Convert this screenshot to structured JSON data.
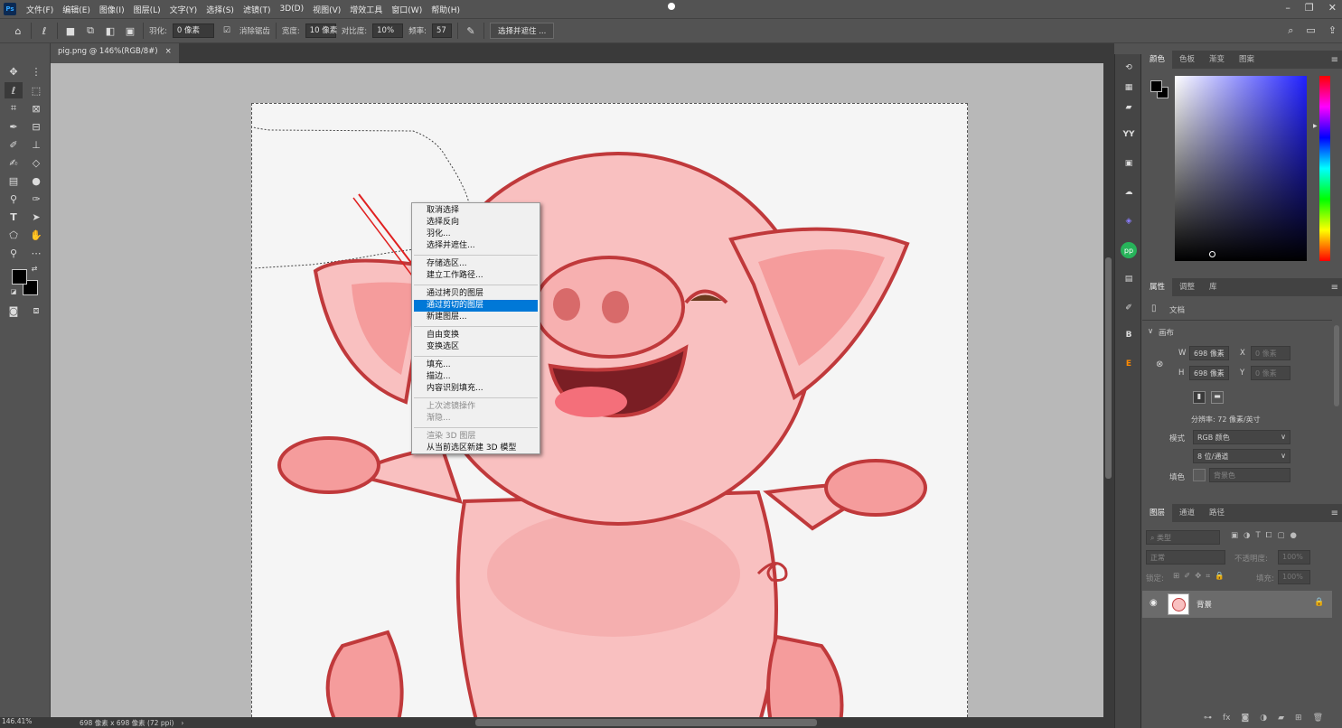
{
  "app": {
    "logo": "Ps"
  },
  "menu": [
    "文件(F)",
    "编辑(E)",
    "图像(I)",
    "图层(L)",
    "文字(Y)",
    "选择(S)",
    "滤镜(T)",
    "3D(D)",
    "视图(V)",
    "增效工具",
    "窗口(W)",
    "帮助(H)"
  ],
  "options": {
    "feather_label": "羽化:",
    "feather_value": "0 像素",
    "antialias_label": "消除锯齿",
    "width_label": "宽度:",
    "width_value": "10 像素",
    "contrast_label": "对比度:",
    "contrast_value": "10%",
    "frequency_label": "频率:",
    "frequency_value": "57",
    "select_mask_button": "选择并遮住 ..."
  },
  "document": {
    "tab_title": "pig.png @ 146%(RGB/8#)",
    "close": "×",
    "zoom": "146.41%",
    "info": "698 像素 x 698 像素 (72 ppi)"
  },
  "context_menu": {
    "items": [
      "取消选择",
      "选择反向",
      "羽化...",
      "选择并遮住...",
      "存储选区...",
      "建立工作路径...",
      "通过拷贝的图层",
      "通过剪切的图层",
      "新建图层...",
      "自由变换",
      "变换选区",
      "填充...",
      "描边...",
      "内容识别填充...",
      "上次滤镜操作",
      "渐隐...",
      "渲染 3D 图层",
      "从当前选区新建 3D 模型"
    ],
    "highlighted": "通过剪切的图层"
  },
  "color_panel": {
    "tabs": [
      "颜色",
      "色板",
      "渐变",
      "图案"
    ]
  },
  "properties_panel": {
    "tabs": [
      "属性",
      "调整",
      "库"
    ],
    "doc_label": "文档",
    "canvas_section": "画布",
    "w_label": "W",
    "w_value": "698 像素",
    "h_label": "H",
    "h_value": "698 像素",
    "x_label": "X",
    "x_placeholder": "0 像素",
    "y_label": "Y",
    "y_placeholder": "0 像素",
    "resolution": "分辨率: 72 像素/英寸",
    "mode_label": "模式",
    "mode_value": "RGB 颜色",
    "depth_value": "8 位/通道",
    "fill_label": "填色",
    "fill_value": "背景色"
  },
  "layers_panel": {
    "tabs": [
      "图层",
      "通道",
      "路径"
    ],
    "filter_placeholder": "类型",
    "blend_mode": "正常",
    "opacity_label": "不透明度:",
    "opacity_value": "100%",
    "lock_label": "锁定:",
    "fill_label": "填充:",
    "fill_value": "100%",
    "layer_name": "背景"
  },
  "colors": {
    "menu_highlight": "#0078d7",
    "pig_outline": "#c0393b",
    "pig_fill": "#f9c0c0"
  }
}
